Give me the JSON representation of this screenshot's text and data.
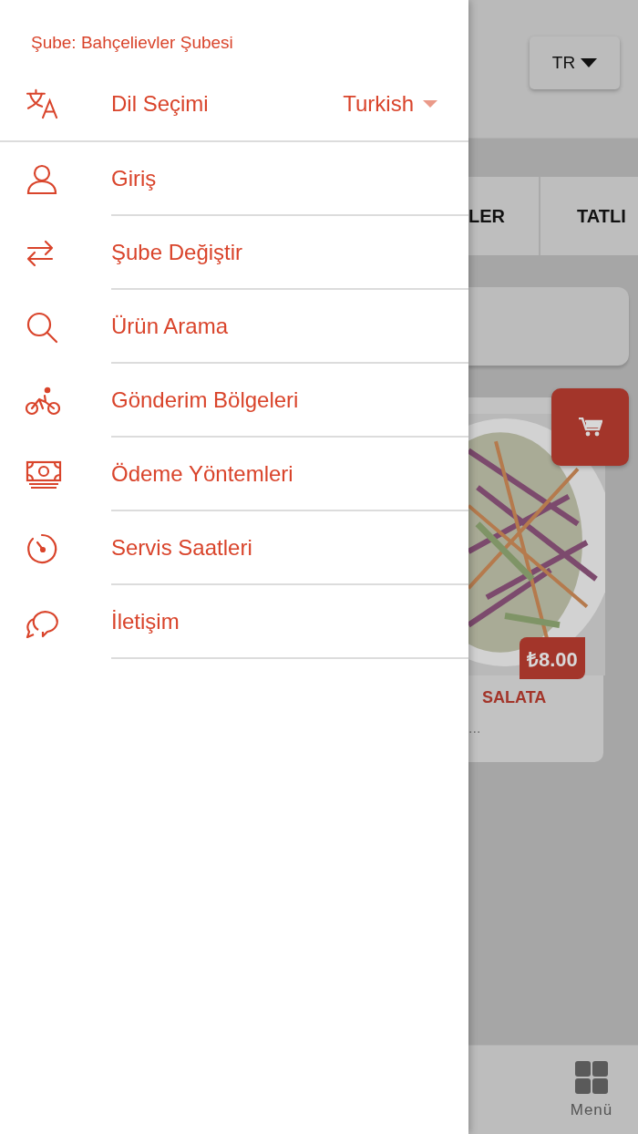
{
  "drawer": {
    "branch_label": "Şube: Bahçelievler Şubesi",
    "language": {
      "label": "Dil Seçimi",
      "value": "Turkish"
    },
    "items": [
      {
        "label": "Giriş",
        "kind": "user"
      },
      {
        "label": "Şube Değiştir",
        "kind": "swap"
      },
      {
        "label": "Ürün Arama",
        "kind": "search"
      },
      {
        "label": "Gönderim Bölgeleri",
        "kind": "bike"
      },
      {
        "label": "Ödeme Yöntemleri",
        "kind": "money"
      },
      {
        "label": "Servis Saatleri",
        "kind": "timer"
      },
      {
        "label": "İletişim",
        "kind": "chat"
      }
    ]
  },
  "background": {
    "language_button": "TR",
    "tabs": [
      {
        "label": "LER"
      },
      {
        "label": "TATLI"
      }
    ],
    "product": {
      "kind": "picture",
      "price": "₺8.00",
      "name": "SALATA",
      "description": "..."
    },
    "bottom_nav": {
      "label": "Menü"
    }
  }
}
